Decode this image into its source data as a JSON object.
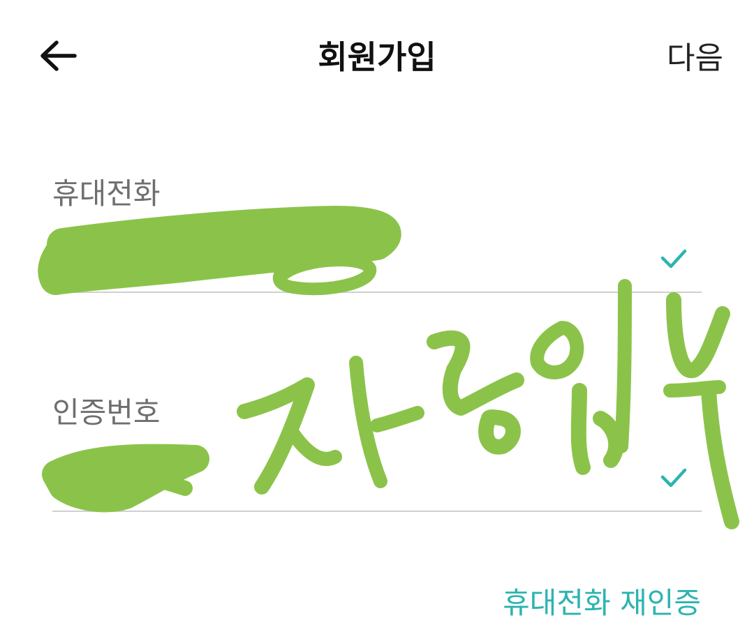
{
  "header": {
    "title": "회원가입",
    "next_label": "다음"
  },
  "form": {
    "phone": {
      "label": "휴대전화",
      "value": ""
    },
    "code": {
      "label": "인증번호",
      "value": ""
    }
  },
  "reauth_label": "휴대전화 재인증",
  "colors": {
    "accent": "#2cb4b0",
    "scribble": "#8bc34a"
  }
}
